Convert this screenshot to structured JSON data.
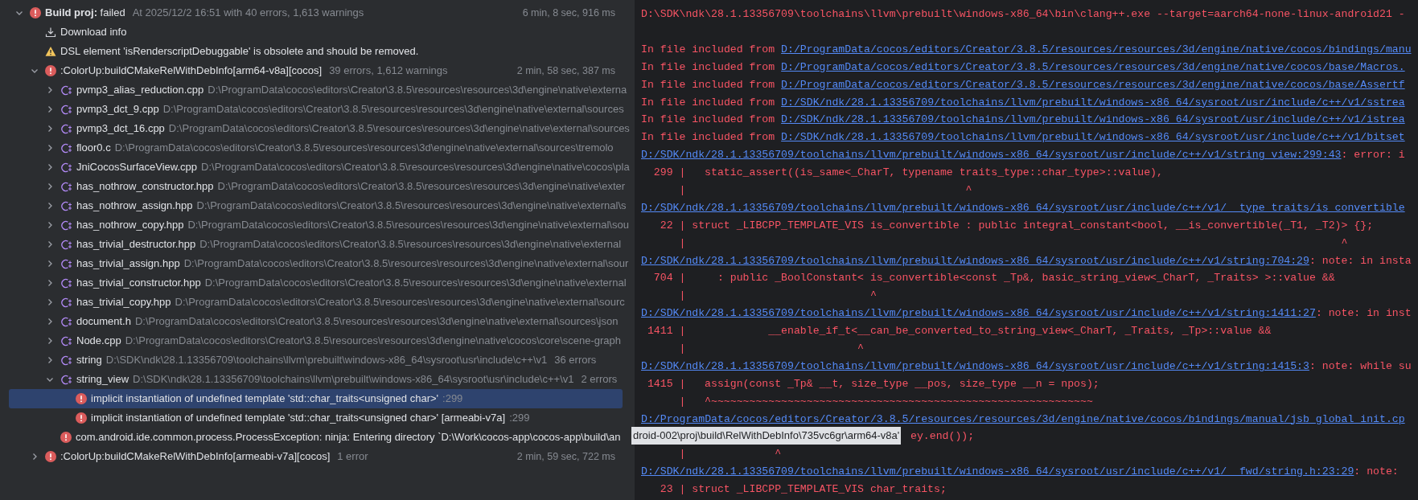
{
  "build_tree": {
    "items": [
      {
        "kind": "task",
        "title": "**Build proj:** failed",
        "meta": "At 2025/12/2 16:51 with 40 errors, 1,613 warnings",
        "time": "6 min, 8 sec, 916 ms",
        "expanded": true,
        "selected": false,
        "children": [
          {
            "kind": "download",
            "title": "Download info",
            "selected": false
          },
          {
            "kind": "warning",
            "title": "DSL element 'isRenderscriptDebuggable' is obsolete and should be removed.",
            "selected": false
          },
          {
            "kind": "task",
            "title": ":ColorUp:buildCMakeRelWithDebInfo[arm64-v8a][cocos]",
            "meta": "39 errors, 1,612 warnings",
            "time": "2 min, 58 sec, 387 ms",
            "expanded": true,
            "selected": false,
            "children": [
              {
                "kind": "file",
                "title": "pvmp3_alias_reduction.cpp",
                "path": "D:\\ProgramData\\cocos\\editors\\Creator\\3.8.5\\resources\\resources\\3d\\engine\\native\\externa",
                "expanded": false,
                "selected": false
              },
              {
                "kind": "file",
                "title": "pvmp3_dct_9.cpp",
                "path": "D:\\ProgramData\\cocos\\editors\\Creator\\3.8.5\\resources\\resources\\3d\\engine\\native\\external\\sources",
                "expanded": false,
                "selected": false
              },
              {
                "kind": "file",
                "title": "pvmp3_dct_16.cpp",
                "path": "D:\\ProgramData\\cocos\\editors\\Creator\\3.8.5\\resources\\resources\\3d\\engine\\native\\external\\sources",
                "expanded": false,
                "selected": false
              },
              {
                "kind": "file",
                "title": "floor0.c",
                "path": "D:\\ProgramData\\cocos\\editors\\Creator\\3.8.5\\resources\\resources\\3d\\engine\\native\\external\\sources\\tremolo",
                "expanded": false,
                "selected": false
              },
              {
                "kind": "file",
                "title": "JniCocosSurfaceView.cpp",
                "path": "D:\\ProgramData\\cocos\\editors\\Creator\\3.8.5\\resources\\resources\\3d\\engine\\native\\cocos\\pla",
                "expanded": false,
                "selected": false
              },
              {
                "kind": "file",
                "title": "has_nothrow_constructor.hpp",
                "path": "D:\\ProgramData\\cocos\\editors\\Creator\\3.8.5\\resources\\resources\\3d\\engine\\native\\exter",
                "expanded": false,
                "selected": false
              },
              {
                "kind": "file",
                "title": "has_nothrow_assign.hpp",
                "path": "D:\\ProgramData\\cocos\\editors\\Creator\\3.8.5\\resources\\resources\\3d\\engine\\native\\external\\s",
                "expanded": false,
                "selected": false
              },
              {
                "kind": "file",
                "title": "has_nothrow_copy.hpp",
                "path": "D:\\ProgramData\\cocos\\editors\\Creator\\3.8.5\\resources\\resources\\3d\\engine\\native\\external\\sou",
                "expanded": false,
                "selected": false
              },
              {
                "kind": "file",
                "title": "has_trivial_destructor.hpp",
                "path": "D:\\ProgramData\\cocos\\editors\\Creator\\3.8.5\\resources\\resources\\3d\\engine\\native\\external",
                "expanded": false,
                "selected": false
              },
              {
                "kind": "file",
                "title": "has_trivial_assign.hpp",
                "path": "D:\\ProgramData\\cocos\\editors\\Creator\\3.8.5\\resources\\resources\\3d\\engine\\native\\external\\sour",
                "expanded": false,
                "selected": false
              },
              {
                "kind": "file",
                "title": "has_trivial_constructor.hpp",
                "path": "D:\\ProgramData\\cocos\\editors\\Creator\\3.8.5\\resources\\resources\\3d\\engine\\native\\external",
                "expanded": false,
                "selected": false
              },
              {
                "kind": "file",
                "title": "has_trivial_copy.hpp",
                "path": "D:\\ProgramData\\cocos\\editors\\Creator\\3.8.5\\resources\\resources\\3d\\engine\\native\\external\\sourc",
                "expanded": false,
                "selected": false
              },
              {
                "kind": "file",
                "title": "document.h",
                "path": "D:\\ProgramData\\cocos\\editors\\Creator\\3.8.5\\resources\\resources\\3d\\engine\\native\\external\\sources\\json",
                "expanded": false,
                "selected": false
              },
              {
                "kind": "file",
                "title": "Node.cpp",
                "path": "D:\\ProgramData\\cocos\\editors\\Creator\\3.8.5\\resources\\resources\\3d\\engine\\native\\cocos\\core\\scene-graph",
                "expanded": false,
                "selected": false
              },
              {
                "kind": "file",
                "title": "string",
                "path": "D:\\SDK\\ndk\\28.1.13356709\\toolchains\\llvm\\prebuilt\\windows-x86_64\\sysroot\\usr\\include\\c++\\v1",
                "meta": "36 errors",
                "expanded": false,
                "selected": false
              },
              {
                "kind": "file",
                "title": "string_view",
                "path": "D:\\SDK\\ndk\\28.1.13356709\\toolchains\\llvm\\prebuilt\\windows-x86_64\\sysroot\\usr\\include\\c++\\v1",
                "meta": "2 errors",
                "expanded": true,
                "selected": false,
                "children": [
                  {
                    "kind": "message",
                    "title": "implicit instantiation of undefined template 'std::char_traits<unsigned char>'",
                    "meta": ":299",
                    "selected": true
                  },
                  {
                    "kind": "message",
                    "title": "implicit instantiation of undefined template 'std::char_traits<unsigned char>' [armeabi-v7a]",
                    "meta": ":299",
                    "selected": false
                  }
                ]
              },
              {
                "kind": "message",
                "title": "com.android.ide.common.process.ProcessException: ninja: Entering directory `D:\\Work\\cocos-app\\cocos-app\\build\\an",
                "selected": false
              }
            ]
          },
          {
            "kind": "task",
            "title": ":ColorUp:buildCMakeRelWithDebInfo[armeabi-v7a][cocos]",
            "meta": "1 error",
            "time": "2 min, 59 sec, 722 ms",
            "expanded": false,
            "selected": false
          }
        ]
      }
    ]
  },
  "tooltip": {
    "text": "droid-002\\proj\\build\\RelWithDebInfo\\735vc6gr\\arm64-v8a'"
  },
  "console": {
    "lines": [
      {
        "kind": "plain",
        "text": "D:\\SDK\\ndk\\28.1.13356709\\toolchains\\llvm\\prebuilt\\windows-x86_64\\bin\\clang++.exe --target=aarch64-none-linux-android21 -"
      },
      {
        "kind": "blank"
      },
      {
        "kind": "include",
        "prefix": "In file included from ",
        "link": "D:/ProgramData/cocos/editors/Creator/3.8.5/resources/resources/3d/engine/native/cocos/bindings/manu"
      },
      {
        "kind": "include",
        "prefix": "In file included from ",
        "link": "D:/ProgramData/cocos/editors/Creator/3.8.5/resources/resources/3d/engine/native/cocos/base/Macros."
      },
      {
        "kind": "include",
        "prefix": "In file included from ",
        "link": "D:/ProgramData/cocos/editors/Creator/3.8.5/resources/resources/3d/engine/native/cocos/base/Assertf"
      },
      {
        "kind": "include",
        "prefix": "In file included from ",
        "link": "D:/SDK/ndk/28.1.13356709/toolchains/llvm/prebuilt/windows-x86_64/sysroot/usr/include/c++/v1/sstrea"
      },
      {
        "kind": "include",
        "prefix": "In file included from ",
        "link": "D:/SDK/ndk/28.1.13356709/toolchains/llvm/prebuilt/windows-x86_64/sysroot/usr/include/c++/v1/istrea"
      },
      {
        "kind": "include",
        "prefix": "In file included from ",
        "link": "D:/SDK/ndk/28.1.13356709/toolchains/llvm/prebuilt/windows-x86_64/sysroot/usr/include/c++/v1/bitset"
      },
      {
        "kind": "location",
        "link": "D:/SDK/ndk/28.1.13356709/toolchains/llvm/prebuilt/windows-x86_64/sysroot/usr/include/c++/v1/string_view:299:43",
        "suffix": ": error: i"
      },
      {
        "kind": "code",
        "number": "299",
        "text": "|   static_assert((is_same<_CharT, typename traits_type::char_type>::value),"
      },
      {
        "kind": "gutter",
        "text": "|                                            ^"
      },
      {
        "kind": "location",
        "link": "D:/SDK/ndk/28.1.13356709/toolchains/llvm/prebuilt/windows-x86_64/sysroot/usr/include/c++/v1/__type_traits/is_convertible"
      },
      {
        "kind": "code",
        "number": "22",
        "text": "| struct _LIBCPP_TEMPLATE_VIS is_convertible : public integral_constant<bool, __is_convertible(_T1, _T2)> {};"
      },
      {
        "kind": "gutter",
        "text": "|                                                                                                       ^"
      },
      {
        "kind": "location",
        "link": "D:/SDK/ndk/28.1.13356709/toolchains/llvm/prebuilt/windows-x86_64/sysroot/usr/include/c++/v1/string:704:29",
        "suffix": ": note: in insta"
      },
      {
        "kind": "code",
        "number": "704",
        "text": "|     : public _BoolConstant< is_convertible<const _Tp&, basic_string_view<_CharT, _Traits> >::value &&"
      },
      {
        "kind": "gutter",
        "text": "|                             ^"
      },
      {
        "kind": "location",
        "link": "D:/SDK/ndk/28.1.13356709/toolchains/llvm/prebuilt/windows-x86_64/sysroot/usr/include/c++/v1/string:1411:27",
        "suffix": ": note: in inst"
      },
      {
        "kind": "code",
        "number": "1411",
        "text": "|             __enable_if_t<__can_be_converted_to_string_view<_CharT, _Traits, _Tp>::value &&"
      },
      {
        "kind": "gutter",
        "text": "|                           ^"
      },
      {
        "kind": "location",
        "link": "D:/SDK/ndk/28.1.13356709/toolchains/llvm/prebuilt/windows-x86_64/sysroot/usr/include/c++/v1/string:1415:3",
        "suffix": ": note: while su"
      },
      {
        "kind": "code",
        "number": "1415",
        "text": "|   assign(const _Tp& __t, size_type __pos, size_type __n = npos);"
      },
      {
        "kind": "gutter",
        "text": "|   ^~~~~~~~~~~~~~~~~~~~~~~~~~~~~~~~~~~~~~~~~~~~~~~~~~~~~~~~~~~~~"
      },
      {
        "kind": "location",
        "link": "D:/ProgramData/cocos/editors/Creator/3.8.5/resources/resources/3d/engine/native/cocos/bindings/manual/jsb_global_init.cp"
      },
      {
        "kind": "covered",
        "text": "ey.end());"
      },
      {
        "kind": "gutter",
        "text": "|              ^"
      },
      {
        "kind": "location",
        "link": "D:/SDK/ndk/28.1.13356709/toolchains/llvm/prebuilt/windows-x86_64/sysroot/usr/include/c++/v1/__fwd/string.h:23:29",
        "suffix": ": note: "
      },
      {
        "kind": "code",
        "number": "23",
        "text": "| struct _LIBCPP_TEMPLATE_VIS char_traits;"
      }
    ]
  }
}
